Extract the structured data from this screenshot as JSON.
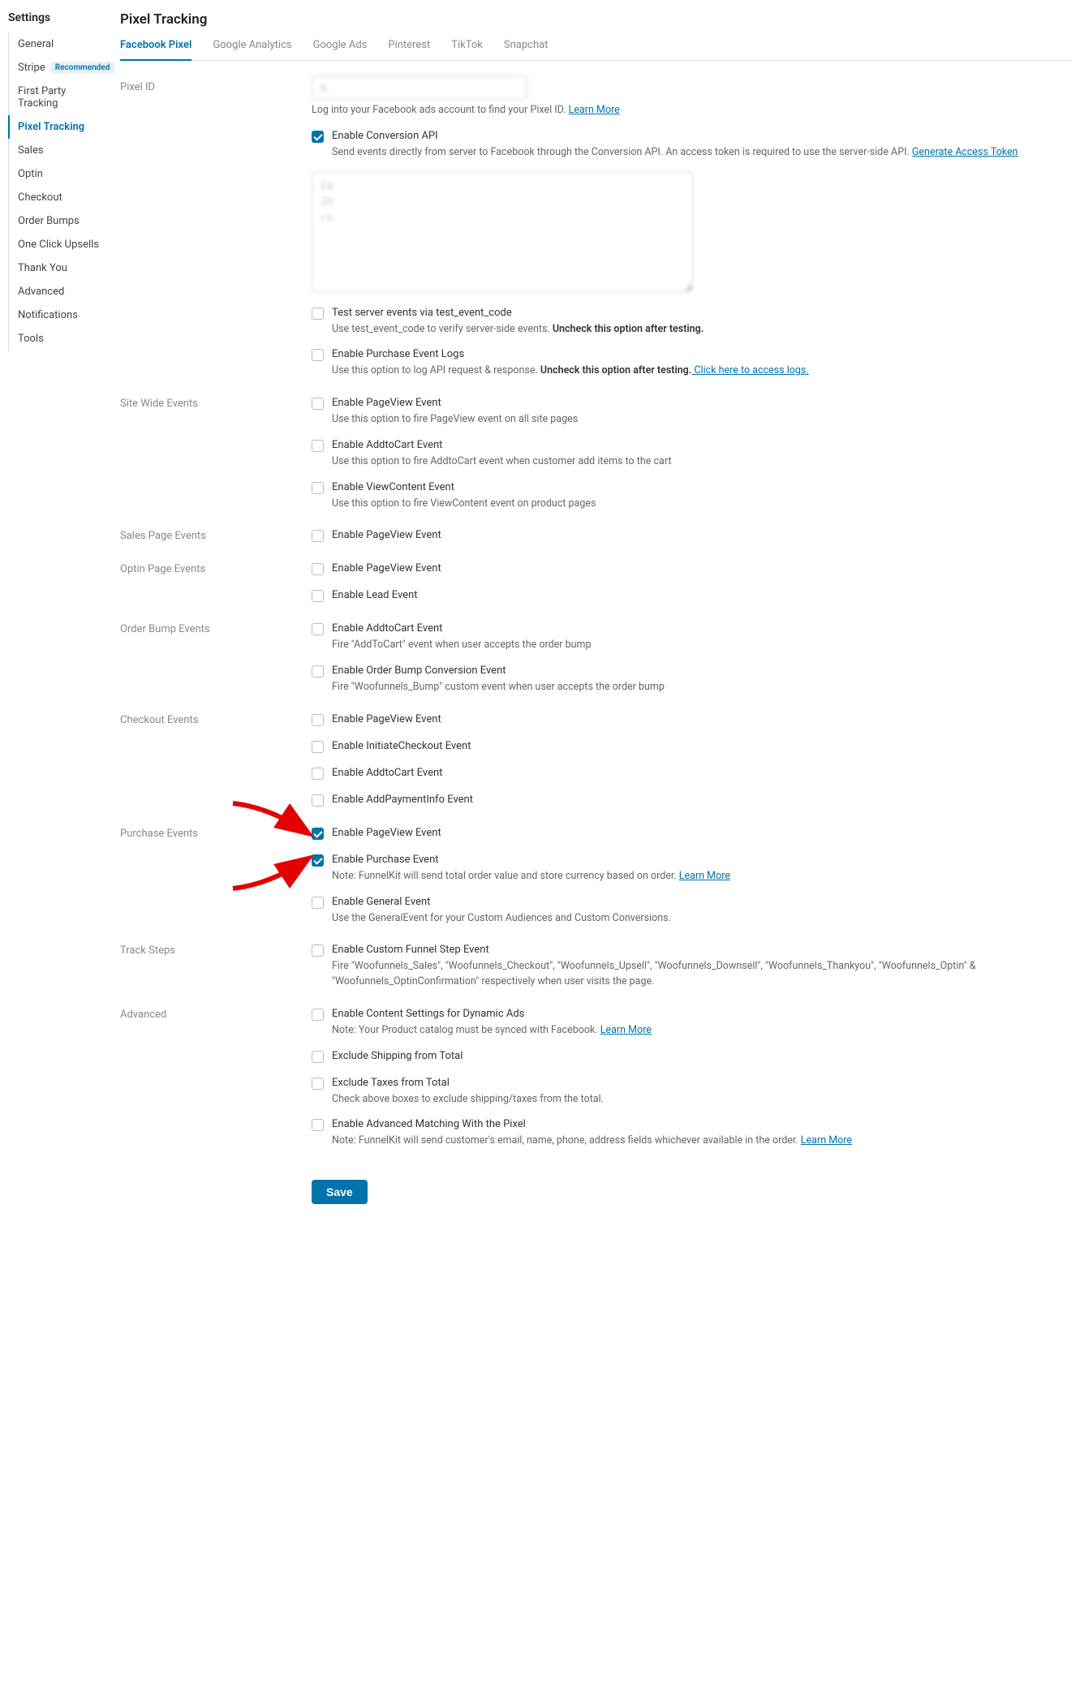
{
  "sidebar": {
    "title": "Settings",
    "items": [
      {
        "label": "General"
      },
      {
        "label": "Stripe",
        "badge": "Recommended"
      },
      {
        "label": "First Party Tracking"
      },
      {
        "label": "Pixel Tracking",
        "active": true
      },
      {
        "label": "Sales"
      },
      {
        "label": "Optin"
      },
      {
        "label": "Checkout"
      },
      {
        "label": "Order Bumps"
      },
      {
        "label": "One Click Upsells"
      },
      {
        "label": "Thank You"
      },
      {
        "label": "Advanced"
      },
      {
        "label": "Notifications"
      },
      {
        "label": "Tools"
      }
    ]
  },
  "page": {
    "title": "Pixel Tracking"
  },
  "tabs": [
    {
      "label": "Facebook Pixel",
      "active": true
    },
    {
      "label": "Google Analytics"
    },
    {
      "label": "Google Ads"
    },
    {
      "label": "Pinterest"
    },
    {
      "label": "TikTok"
    },
    {
      "label": "Snapchat"
    }
  ],
  "sections": {
    "pixel_id": {
      "label": "Pixel ID",
      "value": "5",
      "help_pre": "Log into your Facebook ads account to find your Pixel ID. ",
      "help_link": "Learn More"
    },
    "conv_api": {
      "label": "Enable Conversion API",
      "checked": true,
      "desc_pre": "Send events directly from server to Facebook through the Conversion API. An access token is required to use the server-side API. ",
      "desc_link": "Generate Access Token",
      "textarea_value": "EA\nZA\nch"
    },
    "test_events": {
      "label": "Test server events via test_event_code",
      "desc": "Use test_event_code to verify server-side events. ",
      "desc_strong": "Uncheck this option after testing."
    },
    "purchase_logs": {
      "label": "Enable Purchase Event Logs",
      "desc": "Use this option to log API request & response. ",
      "desc_strong": "Uncheck this option after testing.",
      "desc_link": " Click here to access logs."
    },
    "site_wide": {
      "label": "Site Wide Events",
      "items": [
        {
          "label": "Enable PageView Event",
          "desc": "Use this option to fire PageView event on all site pages"
        },
        {
          "label": "Enable AddtoCart Event",
          "desc": "Use this option to fire AddtoCart event when customer add items to the cart"
        },
        {
          "label": "Enable ViewContent Event",
          "desc": "Use this option to fire ViewContent event on product pages"
        }
      ]
    },
    "sales_page": {
      "label": "Sales Page Events",
      "items": [
        {
          "label": "Enable PageView Event"
        }
      ]
    },
    "optin_page": {
      "label": "Optin Page Events",
      "items": [
        {
          "label": "Enable PageView Event"
        },
        {
          "label": "Enable Lead Event"
        }
      ]
    },
    "order_bump": {
      "label": "Order Bump Events",
      "items": [
        {
          "label": "Enable AddtoCart Event",
          "desc": "Fire \"AddToCart\" event when user accepts the order bump"
        },
        {
          "label": "Enable Order Bump Conversion Event",
          "desc": "Fire \"Woofunnels_Bump\" custom event when user accepts the order bump"
        }
      ]
    },
    "checkout": {
      "label": "Checkout Events",
      "items": [
        {
          "label": "Enable PageView Event"
        },
        {
          "label": "Enable InitiateCheckout Event"
        },
        {
          "label": "Enable AddtoCart Event"
        },
        {
          "label": "Enable AddPaymentInfo Event"
        }
      ]
    },
    "purchase": {
      "label": "Purchase Events",
      "items": [
        {
          "label": "Enable PageView Event",
          "checked": true,
          "arrow": true
        },
        {
          "label": "Enable Purchase Event",
          "checked": true,
          "arrow": true,
          "desc": "Note: FunnelKit will send total order value and store currency based on order. ",
          "link": "Learn More"
        },
        {
          "label": "Enable General Event",
          "desc": "Use the GeneralEvent for your Custom Audiences and Custom Conversions."
        }
      ]
    },
    "track_steps": {
      "label": "Track Steps",
      "items": [
        {
          "label": "Enable Custom Funnel Step Event",
          "desc": "Fire \"Woofunnels_Sales\", \"Woofunnels_Checkout\", \"Woofunnels_Upsell\", \"Woofunnels_Downsell\", \"Woofunnels_Thankyou\", \"Woofunnels_Optin\" & \"Woofunnels_OptinConfirmation\" respectively when user visits the page."
        }
      ]
    },
    "advanced": {
      "label": "Advanced",
      "items": [
        {
          "label": "Enable Content Settings for Dynamic Ads",
          "desc": "Note: Your Product catalog must be synced with Facebook. ",
          "link": "Learn More"
        },
        {
          "label": "Exclude Shipping from Total"
        },
        {
          "label": "Exclude Taxes from Total",
          "desc": "Check above boxes to exclude shipping/taxes from the total."
        },
        {
          "label": "Enable Advanced Matching With the Pixel",
          "desc": "Note: FunnelKit will send customer's email, name, phone, address fields whichever available in the order. ",
          "link": "Learn More"
        }
      ]
    }
  },
  "save": "Save"
}
